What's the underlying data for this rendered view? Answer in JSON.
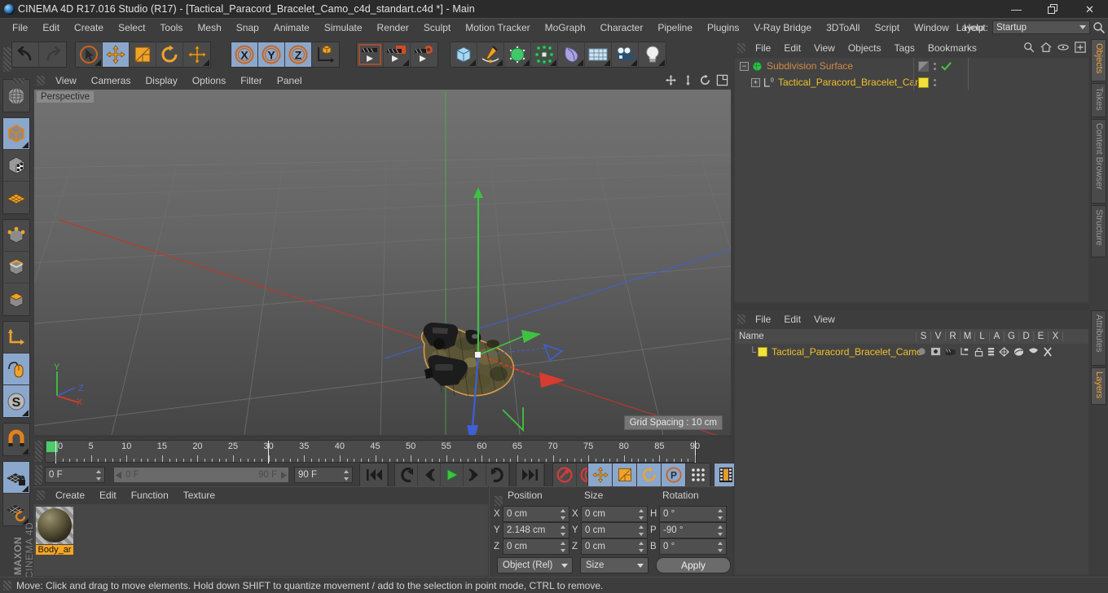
{
  "window": {
    "title": "CINEMA 4D R17.016 Studio (R17) - [Tactical_Paracord_Bracelet_Camo_c4d_standart.c4d *] - Main",
    "minimize": "—",
    "maximize": "❐",
    "close": "✕",
    "brand": "MAXON",
    "brand2": "CINEMA 4D"
  },
  "menubar": {
    "items": [
      "File",
      "Edit",
      "Create",
      "Select",
      "Tools",
      "Mesh",
      "Snap",
      "Animate",
      "Simulate",
      "Render",
      "Sculpt",
      "Motion Tracker",
      "MoGraph",
      "Character",
      "Pipeline",
      "Plugins",
      "V-Ray Bridge",
      "3DToAll",
      "Script",
      "Window",
      "Help"
    ],
    "layout_label": "Layout:",
    "layout_value": "Startup",
    "search_icon": "search-icon"
  },
  "toolbar": {
    "groups": [
      {
        "name": "undo-redo",
        "buttons": [
          {
            "name": "undo-button",
            "icon": "undo-arrow-icon",
            "active": false
          },
          {
            "name": "redo-button",
            "icon": "redo-arrow-icon",
            "active": false,
            "dim": true
          }
        ]
      },
      {
        "name": "transform-tools",
        "buttons": [
          {
            "name": "live-selection-tool",
            "icon": "cursor-circle-icon",
            "active": false,
            "corner": true
          },
          {
            "name": "move-tool",
            "icon": "move-arrows-icon",
            "active": true
          },
          {
            "name": "scale-tool",
            "icon": "scale-box-icon",
            "active": false
          },
          {
            "name": "rotate-tool",
            "icon": "rotate-arc-icon",
            "active": false
          },
          {
            "name": "transform-tool",
            "icon": "move-arrows-icon",
            "active": false,
            "corner": true
          }
        ]
      },
      {
        "name": "axis-locks",
        "buttons": [
          {
            "name": "lock-x-axis-button",
            "icon": "x-axis-icon",
            "active": true
          },
          {
            "name": "lock-y-axis-button",
            "icon": "y-axis-icon",
            "active": true
          },
          {
            "name": "lock-z-axis-button",
            "icon": "z-axis-icon",
            "active": true
          },
          {
            "name": "world-object-coordinates-button",
            "icon": "world-axis-cube-icon",
            "active": false
          }
        ]
      },
      {
        "name": "render-tools",
        "buttons": [
          {
            "name": "render-view-button",
            "icon": "clapperboard-frame-icon",
            "active": false
          },
          {
            "name": "render-to-picture-viewer-button",
            "icon": "clapperboard-window-icon",
            "active": false,
            "corner": true
          },
          {
            "name": "render-settings-button",
            "icon": "clapperboard-gear-icon",
            "active": false
          }
        ]
      },
      {
        "name": "object-creation",
        "buttons": [
          {
            "name": "add-cube-button",
            "icon": "blue-cube-icon",
            "active": false,
            "corner": true
          },
          {
            "name": "add-spline-button",
            "icon": "pen-spline-icon",
            "active": false,
            "corner": true
          },
          {
            "name": "add-generator-button",
            "icon": "green-cube-nurbs-icon",
            "active": false,
            "corner": true
          },
          {
            "name": "add-array-button",
            "icon": "green-array-icon",
            "active": false,
            "corner": true
          },
          {
            "name": "add-deformer-button",
            "icon": "bend-deformer-icon",
            "active": false,
            "corner": true
          },
          {
            "name": "add-scene-object-button",
            "icon": "floor-grid-icon",
            "active": false,
            "corner": true
          },
          {
            "name": "add-camera-button",
            "icon": "camera-icon",
            "active": false,
            "corner": true
          },
          {
            "name": "add-light-button",
            "icon": "light-bulb-icon",
            "active": false,
            "corner": true
          }
        ]
      }
    ]
  },
  "leftbar": {
    "groups": [
      {
        "buttons": [
          {
            "name": "make-editable-button",
            "icon": "globe-wire-icon",
            "active": false
          }
        ]
      },
      {
        "buttons": [
          {
            "name": "model-mode-button",
            "icon": "orange-cube-icon",
            "active": true,
            "corner": true
          },
          {
            "name": "texture-mode-button",
            "icon": "checker-cube-icon",
            "active": false
          },
          {
            "name": "uv-mesh-mode-button",
            "icon": "orange-mesh-icon",
            "active": false
          }
        ]
      },
      {
        "buttons": [
          {
            "name": "points-mode-button",
            "icon": "cube-points-icon",
            "active": false
          },
          {
            "name": "edges-mode-button",
            "icon": "cube-edges-icon",
            "active": false
          },
          {
            "name": "polygons-mode-button",
            "icon": "cube-polygons-icon",
            "active": false
          }
        ]
      },
      {
        "buttons": [
          {
            "name": "object-axis-mode-button",
            "icon": "axis-l-icon",
            "active": false
          },
          {
            "name": "enable-axis-modification-button",
            "icon": "mouse-axis-icon",
            "active": true
          },
          {
            "name": "soft-selection-button",
            "icon": "s-circle-icon",
            "active": true,
            "corner": true
          }
        ]
      },
      {
        "buttons": [
          {
            "name": "snap-magnet-button",
            "icon": "magnet-icon",
            "active": false,
            "corner": true
          }
        ]
      },
      {
        "buttons": [
          {
            "name": "workplane-lock-button",
            "icon": "grid-lock-icon",
            "active": true,
            "corner": true
          },
          {
            "name": "workplane-rotate-button",
            "icon": "grid-rotate-icon",
            "active": false,
            "corner": true
          }
        ]
      }
    ]
  },
  "viewport": {
    "menu": [
      "View",
      "Cameras",
      "Display",
      "Options",
      "Filter",
      "Panel"
    ],
    "label": "Perspective",
    "grid_spacing": "Grid Spacing : 10 cm",
    "icons": [
      "pan-icon",
      "dolly-icon",
      "rotate-view-icon",
      "maximize-view-icon"
    ],
    "axis_gizmo": {
      "y": "Y",
      "z": "Z",
      "x": "X"
    }
  },
  "timeline": {
    "ticks": [
      "0",
      "5",
      "10",
      "15",
      "20",
      "25",
      "30",
      "35",
      "40",
      "45",
      "50",
      "55",
      "60",
      "65",
      "70",
      "75",
      "80",
      "85",
      "90"
    ],
    "current_frame": "0 F",
    "range_start": "0 F",
    "range_end": "90 F",
    "max_frame": "90 F",
    "preview_frame": "0 F",
    "buttons": [
      {
        "name": "go-to-start-button",
        "icon": "skip-start-icon"
      },
      {
        "name": "go-to-previous-key-button",
        "icon": "prev-key-icon"
      },
      {
        "name": "go-to-previous-frame-button",
        "icon": "step-back-icon"
      },
      {
        "name": "play-button",
        "icon": "play-icon"
      },
      {
        "name": "go-to-next-frame-button",
        "icon": "step-forward-icon"
      },
      {
        "name": "go-to-next-key-button",
        "icon": "next-key-icon"
      },
      {
        "name": "go-to-end-button",
        "icon": "skip-end-icon"
      },
      {
        "name": "record-active-objects-button",
        "icon": "record-key-icon"
      },
      {
        "name": "autokeying-button",
        "icon": "autokey-circle-icon"
      },
      {
        "name": "keyframe-selection-button",
        "icon": "question-circle-icon"
      },
      {
        "name": "position-key-button",
        "icon": "move-arrows-icon",
        "active": true
      },
      {
        "name": "scale-key-button",
        "icon": "scale-box-icon",
        "active": true
      },
      {
        "name": "rotation-key-button",
        "icon": "rotate-arc-icon",
        "active": true
      },
      {
        "name": "param-key-button",
        "icon": "p-circle-icon",
        "active": true
      },
      {
        "name": "pla-key-button",
        "icon": "point-grid-icon",
        "active": false
      },
      {
        "name": "timeline-button",
        "icon": "film-strip-icon",
        "active": true
      }
    ]
  },
  "material_manager": {
    "menu": [
      "Create",
      "Edit",
      "Function",
      "Texture"
    ],
    "materials": [
      {
        "name": "Body_ar"
      }
    ]
  },
  "coordinates": {
    "headers": [
      "Position",
      "Size",
      "Rotation"
    ],
    "rows": [
      {
        "axis1": "X",
        "pos": "0 cm",
        "axis2": "X",
        "size": "0 cm",
        "axis3": "H",
        "rot": "0 °"
      },
      {
        "axis1": "Y",
        "pos": "2.148 cm",
        "axis2": "Y",
        "size": "0 cm",
        "axis3": "P",
        "rot": "-90 °"
      },
      {
        "axis1": "Z",
        "pos": "0 cm",
        "axis2": "Z",
        "size": "0 cm",
        "axis3": "B",
        "rot": "0 °"
      }
    ],
    "mode_dropdown": "Object (Rel)",
    "size_dropdown": "Size",
    "apply_button": "Apply"
  },
  "object_manager": {
    "menu": [
      "File",
      "Edit",
      "View",
      "Objects",
      "Tags",
      "Bookmarks"
    ],
    "icons": [
      "search-icon",
      "home-icon",
      "eye-icon",
      "new-tab-icon"
    ],
    "items": [
      {
        "name": "Subdivision Surface",
        "color": "#d08a4a",
        "icon": "subdivision-surface-icon",
        "indent": 6,
        "check": true
      },
      {
        "name": "Tactical_Paracord_Bracelet_Camo",
        "color": "#f0c12b",
        "icon": "polygon-object-icon",
        "indent": 20,
        "check": false
      }
    ]
  },
  "attribute_manager": {
    "menu": [
      "File",
      "Edit",
      "View"
    ],
    "columns": [
      "Name",
      "S",
      "V",
      "R",
      "M",
      "L",
      "A",
      "G",
      "D",
      "E",
      "X"
    ],
    "rows": [
      {
        "name": "Tactical_Paracord_Bracelet_Camo",
        "color": "#f0c12b"
      }
    ]
  },
  "right_tabs": [
    {
      "label": "Objects",
      "active": true
    },
    {
      "label": "Takes",
      "active": false
    },
    {
      "label": "Content Browser",
      "active": false
    },
    {
      "label": "Structure",
      "active": false
    },
    {
      "label": "Attributes",
      "active": false
    },
    {
      "label": "Layers",
      "active": true
    }
  ],
  "statusbar": {
    "text": "Move: Click and drag to move elements. Hold down SHIFT to quantize movement / add to the selection in point mode, CTRL to remove."
  },
  "colors": {
    "accent_orange": "#f0a23c",
    "selected_blue": "#8ba7cc",
    "panel_bg": "#3d3d3d",
    "axis_x": "#d63c2f",
    "axis_y": "#3fc23f",
    "axis_z": "#3f5fd6"
  }
}
